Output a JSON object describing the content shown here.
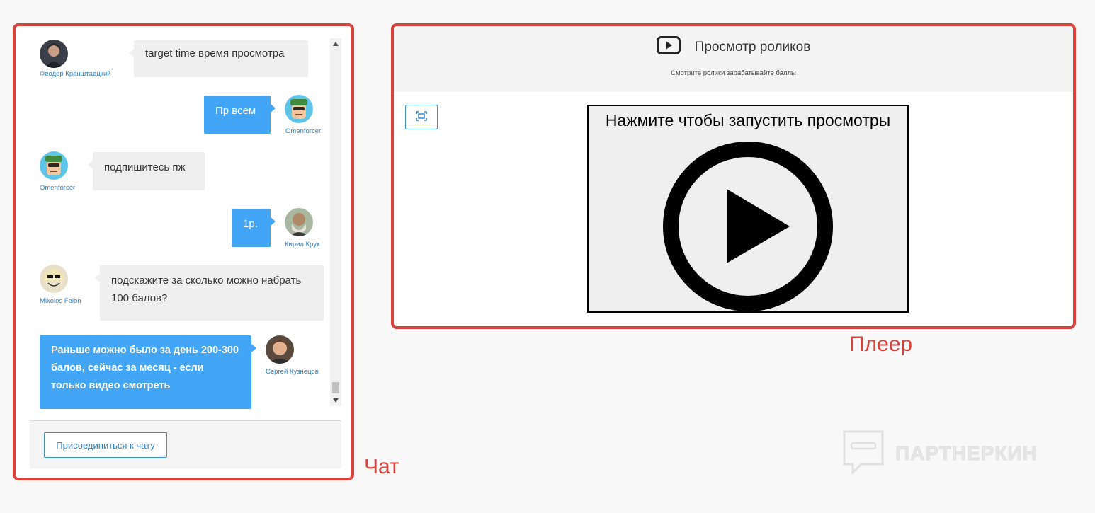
{
  "chat": {
    "caption": "Чат",
    "join_button": "Присоединиться к чату",
    "messages": [
      {
        "user": "Феодор Кранштадцкий",
        "text": "target time время просмотра",
        "side": "left"
      },
      {
        "user": "Omenforcer",
        "text": "Пр всем",
        "side": "right"
      },
      {
        "user": "Omenforcer",
        "text": "подпишитесь пж",
        "side": "left"
      },
      {
        "user": "Кирил Крук",
        "text": "1р.",
        "side": "right"
      },
      {
        "user": "Mikolos Falon",
        "text": "подскажите за сколько можно набрать 100 балов?",
        "side": "left"
      },
      {
        "user": "Сергей Кузнецов",
        "text": "Раньше можно было за день 200-300 балов, сейчас за месяц - если только видео смотреть",
        "side": "right"
      }
    ]
  },
  "player": {
    "caption": "Плеер",
    "title": "Просмотр роликов",
    "subtitle": "Смотрите ролики зарабатывайте баллы",
    "video_prompt": "Нажмите чтобы запустить просмотры"
  },
  "watermark": {
    "text": "ПАРТНЕРКИН"
  },
  "colors": {
    "frame_red": "#d9413a",
    "bubble_blue": "#42a5f5",
    "bubble_gray": "#efefef",
    "link_blue": "#2f7fc1"
  },
  "icons": [
    "play-square-icon",
    "fullscreen-icon",
    "big-play-icon",
    "scroll-up-icon",
    "scroll-down-icon",
    "watermark-logo-icon"
  ]
}
